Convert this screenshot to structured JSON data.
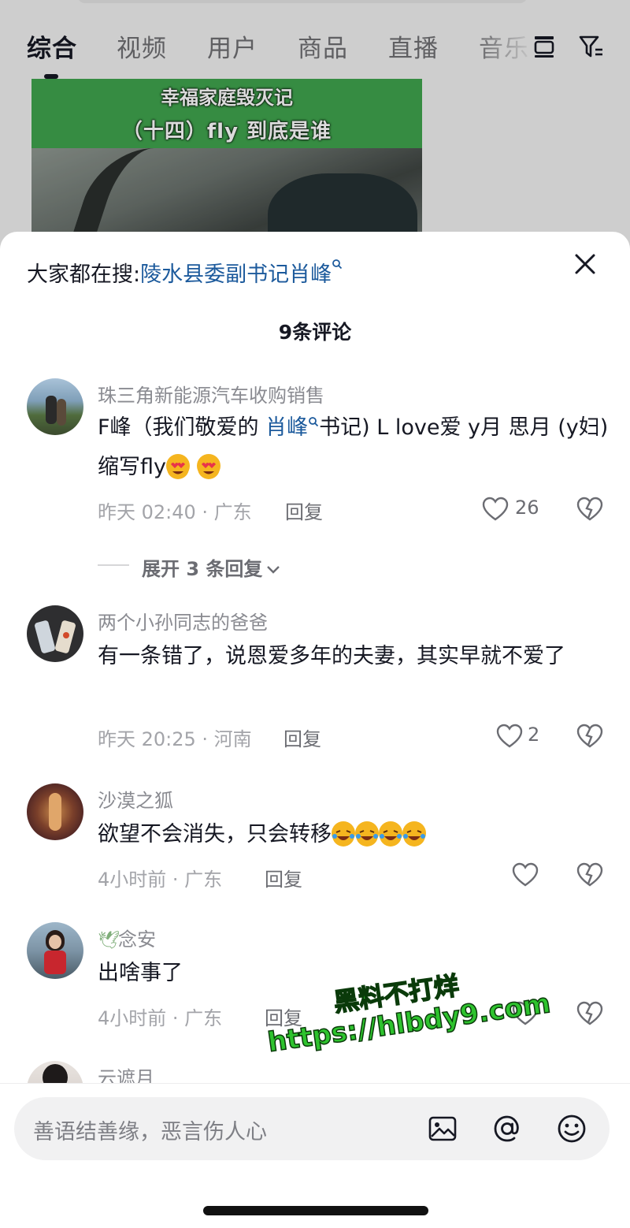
{
  "tabs": [
    {
      "label": "综合",
      "active": true
    },
    {
      "label": "视频",
      "active": false
    },
    {
      "label": "用户",
      "active": false
    },
    {
      "label": "商品",
      "active": false
    },
    {
      "label": "直播",
      "active": false
    },
    {
      "label": "音乐",
      "active": false
    }
  ],
  "video": {
    "line1": "幸福家庭毁灭记",
    "line2": "（十四）fly 到底是谁"
  },
  "sheet": {
    "hot_search_prefix": "大家都在搜:",
    "hot_search_term": "陵水县委副书记肖峰",
    "comment_count": "9条评论"
  },
  "comments": [
    {
      "user": "珠三角新能源汽车收购销售",
      "text_before": "F峰（我们敬爱的 ",
      "text_link": "肖峰",
      "text_after": "书记) L love爱 y月 思月 (y妇) 缩写fly",
      "time_place": "昨天 02:40 · 广东",
      "reply": "回复",
      "likes": "26",
      "expand": "展开 3 条回复"
    },
    {
      "user": "两个小孙同志的爸爸",
      "text": "有一条错了，说恩爱多年的夫妻，其实早就不爱了",
      "time_place": "昨天 20:25 · 河南",
      "reply": "回复",
      "likes": "2"
    },
    {
      "user": "沙漠之狐",
      "text": "欲望不会消失，只会转移",
      "time_place": "4小时前 · 广东",
      "reply": "回复",
      "likes": ""
    },
    {
      "user": "念安",
      "text": "出啥事了",
      "time_place": "4小时前 · 广东",
      "reply": "回复",
      "likes": ""
    },
    {
      "user": "云遮月"
    }
  ],
  "input": {
    "placeholder": "善语结善缘，恶言伤人心"
  },
  "watermark": {
    "line1": "黑料不打烊",
    "line2": "https://hlbdy9.com"
  },
  "icons": [
    "layout-icon",
    "filter-icon",
    "close-icon",
    "search-icon",
    "heart-icon",
    "broken-heart-icon",
    "image-icon",
    "at-icon",
    "emoji-icon"
  ],
  "colors": {
    "link": "#1c5a9c",
    "muted": "#8a8b91",
    "watermark": "#2ec32e"
  }
}
